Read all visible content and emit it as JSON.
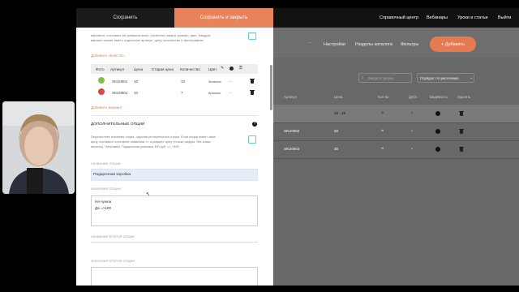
{
  "topbar": {
    "save_label": "Сохранить",
    "save_close_label": "Сохранить и закрыть",
    "nav": [
      "Справочный центр",
      "Вебинары",
      "Уроки и статьи",
      "Выйти"
    ]
  },
  "editor": {
    "intro_text_1": "варианте: поставьте её флажком вниз. Свойства товара: размер, цвет. Каждый",
    "intro_text_2": "вариант может иметь отдельные артикул, цену, количество и фотографию.",
    "add_property": "Добавить свойство",
    "variants_table": {
      "headers": [
        "Фото",
        "Артикул",
        "Цена",
        "Старая цена",
        "Количество",
        "Цвет"
      ],
      "rows": [
        {
          "sku": "SKU0001",
          "price": "10",
          "old_price": "",
          "qty": "10",
          "color": "Зеленое"
        },
        {
          "sku": "SKU0001",
          "price": "10",
          "old_price": "",
          "qty": "7",
          "color": "Красное"
        }
      ]
    },
    "add_variant": "Добавить вариант",
    "options_title": "ДОПОЛНИТЕЛЬНЫЕ ОПЦИИ",
    "options_desc_1": "Перечислите значения опции, отделяя их переносом строки. Если опция имеет свою",
    "options_desc_2": "цену, поставьте сочетание символов => и укажите цену (только цифры, без знака",
    "options_desc_3": "валюты). Например: Подарочная упаковка 300 руб. => +300",
    "option_name_label": "НАЗВАНИЕ ОПЦИИ",
    "option_name_value": "Подарочная коробка",
    "option_values_label": "ЗНАЧЕНИЯ ОПЦИИ",
    "option_values_line1": "Не нужна",
    "option_values_line2": "Да =>100",
    "option2_name_label": "НАЗВАНИЕ ВТОРОЙ ОПЦИИ",
    "option2_values_label": "ЗНАЧЕНИЯ ВТОРОЙ ОПЦИИ"
  },
  "catalog": {
    "more": "···",
    "settings": "Настройки",
    "sections": "Разделы каталога",
    "filters": "Фильтры",
    "add_button": "+ Добавить",
    "search_placeholder": "Введите запрос",
    "sort": "Порядок: по умолчанию",
    "headers": [
      "Артикул",
      "Цена",
      "Кол-во",
      "Дубл.",
      "Видимость",
      "Удалить"
    ],
    "rows": [
      {
        "sku": "",
        "price": "10 - 15",
        "qty": "∞"
      },
      {
        "sku": "SKU0002",
        "price": "20",
        "qty": "∞"
      },
      {
        "sku": "SKU0003",
        "price": "30",
        "qty": "∞"
      }
    ]
  },
  "colors": {
    "accent": "#e8825a",
    "topbar": "#111111",
    "overlay": "#686868"
  }
}
